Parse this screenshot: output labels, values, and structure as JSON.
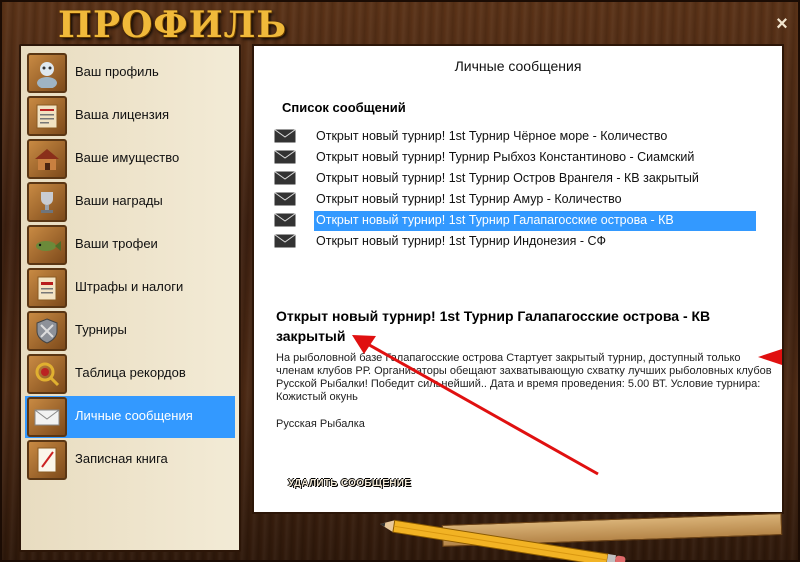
{
  "window": {
    "title": "ПРОФИЛЬ",
    "close_label": "×"
  },
  "menu": {
    "items": [
      {
        "label": "Ваш профиль",
        "icon": "profile-icon"
      },
      {
        "label": "Ваша лицензия",
        "icon": "license-icon"
      },
      {
        "label": "Ваше имущество",
        "icon": "property-icon"
      },
      {
        "label": "Ваши награды",
        "icon": "awards-icon"
      },
      {
        "label": "Ваши трофеи",
        "icon": "trophies-icon"
      },
      {
        "label": "Штрафы и налоги",
        "icon": "fines-icon"
      },
      {
        "label": "Турниры",
        "icon": "tournaments-icon"
      },
      {
        "label": "Таблица рекордов",
        "icon": "records-icon"
      },
      {
        "label": "Личные сообщения",
        "icon": "envelope-icon",
        "active": true
      },
      {
        "label": "Записная книга",
        "icon": "notebook-icon"
      }
    ]
  },
  "content": {
    "header": "Личные сообщения",
    "list_title": "Список сообщений",
    "messages": [
      {
        "subject": "Открыт новый турнир! 1st Турнир Чёрное море - Количество"
      },
      {
        "subject": "Открыт новый турнир! Турнир Рыбхоз Константиново - Сиамский"
      },
      {
        "subject": "Открыт новый турнир! 1st Турнир Остров Врангеля - КВ закрытый"
      },
      {
        "subject": "Открыт новый турнир! 1st Турнир Амур - Количество"
      },
      {
        "subject": "Открыт новый турнир! 1st Турнир Галапагосские острова - КВ",
        "selected": true
      },
      {
        "subject": "Открыт новый турнир! 1st Турнир Индонезия - СФ"
      }
    ],
    "detail": {
      "title": "Открыт новый турнир! 1st Турнир Галапагосские острова - КВ закрытый",
      "body": "На рыболовной базе Галапагосские острова Стартует закрытый турнир, доступный только членам клубов РР. Организаторы обещают захватывающую схватку лучших рыболовных клубов Русской Рыбалки! Победит сильнейший.. Дата и время проведения: 5.00 ВТ. Условие турнира: Кожистый окунь",
      "signature": "Русская Рыбалка"
    },
    "delete_label": "УДАЛИТЬ СООБЩЕНИЕ"
  },
  "colors": {
    "selection": "#3399ff",
    "title_gold": "#f0b93a",
    "annotation_red": "#e01010"
  }
}
